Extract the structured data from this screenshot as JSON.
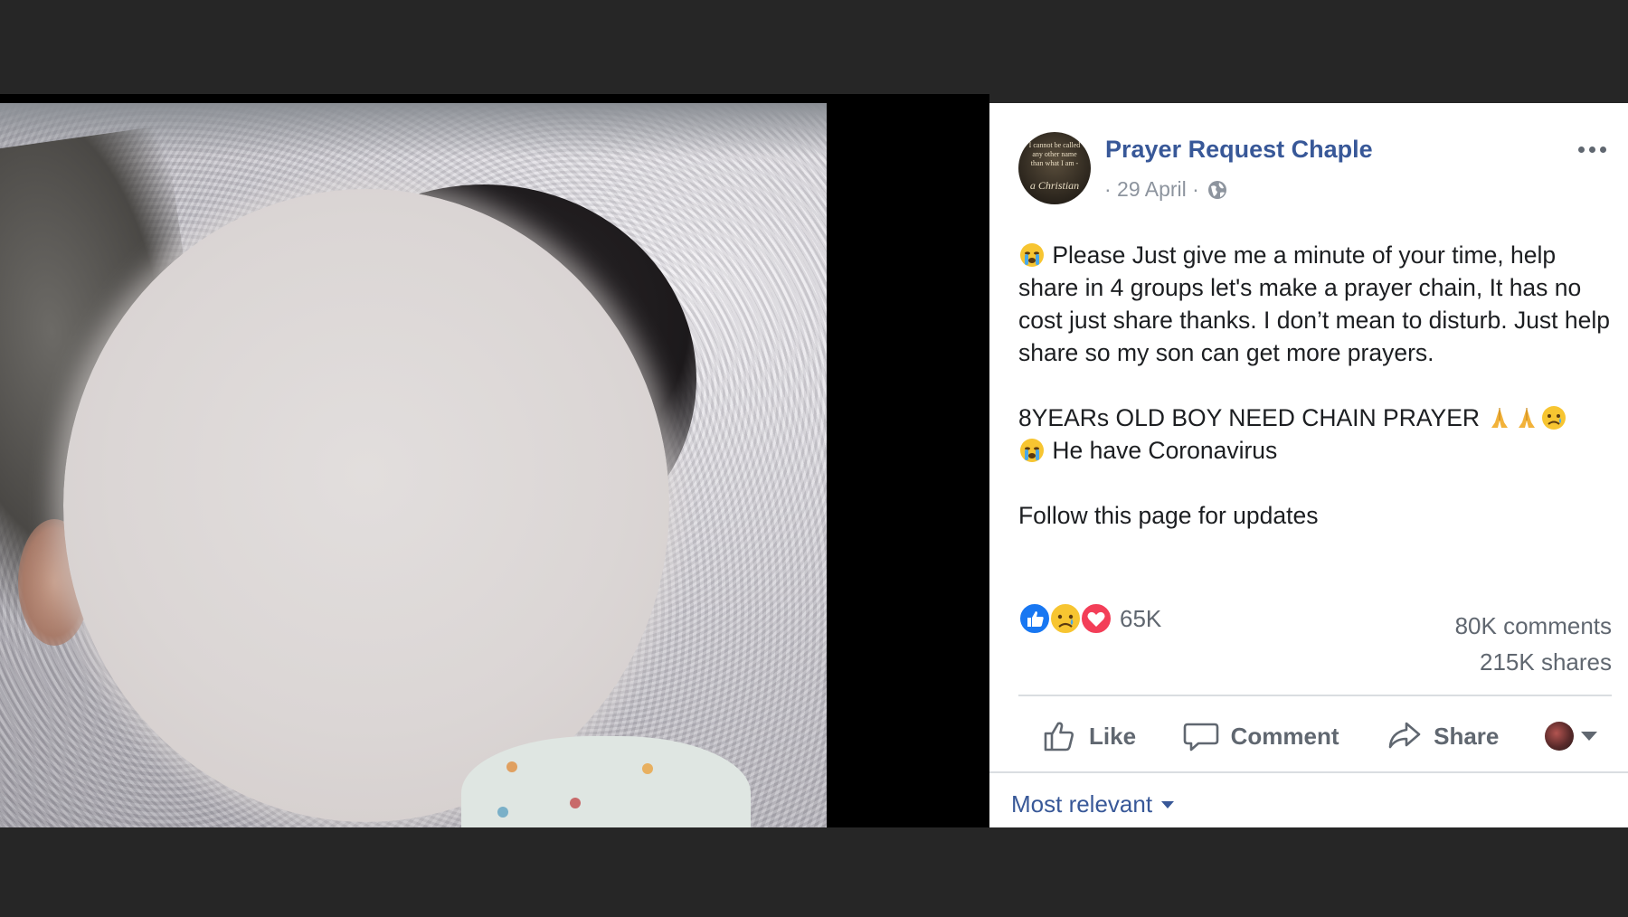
{
  "post": {
    "page_name": "Prayer Request Chaple",
    "meta": "· 29 April ·",
    "avatar_text": {
      "lines": "I cannot be called any other name than what I am -",
      "big": "a Christian"
    },
    "paragraph1": " Please Just give me a minute of your time, help share in 4 groups let's make a prayer chain, It has no cost just share thanks. I don’t mean to disturb. Just help share so my son can get more prayers.",
    "paragraph2_line1": "8YEARs OLD BOY NEED CHAIN PRAYER ",
    "paragraph2_line2": " He have Coronavirus",
    "paragraph3": "Follow this page for updates"
  },
  "reactions": {
    "count": "65K",
    "types": [
      "like-icon",
      "sad-icon",
      "love-icon"
    ]
  },
  "counts": {
    "comments": "80K comments",
    "shares": "215K shares"
  },
  "actions": {
    "like": "Like",
    "comment": "Comment",
    "share": "Share"
  },
  "comments_filter": "Most relevant",
  "colors": {
    "link": "#385898",
    "muted": "#606770",
    "text": "#1c1e21",
    "like_blue": "#1877f2",
    "love_red": "#f33e58"
  }
}
